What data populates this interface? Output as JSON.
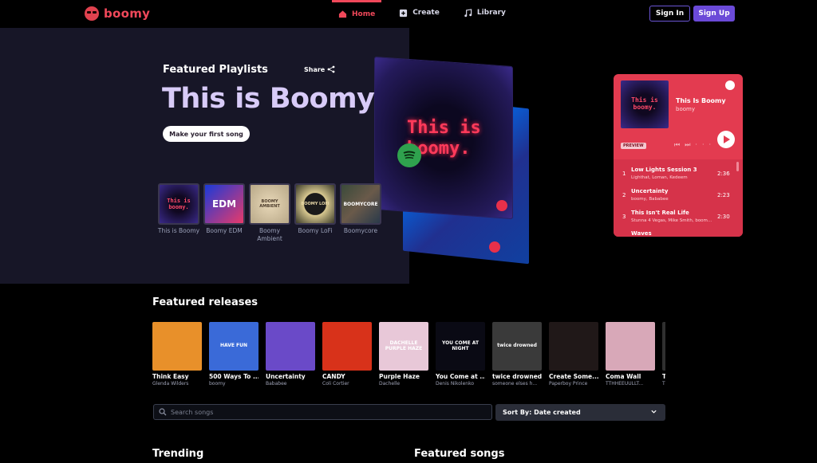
{
  "nav": {
    "logo_text": "boomy",
    "links": [
      {
        "label": "Home",
        "icon": "home-icon"
      },
      {
        "label": "Create",
        "icon": "plus-square-icon"
      },
      {
        "label": "Library",
        "icon": "music-note-icon"
      }
    ],
    "signin_label": "Sign In",
    "signup_label": "Sign Up"
  },
  "hero": {
    "subtitle": "Featured Playlists",
    "share_label": "Share",
    "title": "This is Boomy",
    "cta_label": "Make your first song",
    "playlists": [
      {
        "label": "This is Boomy",
        "art_text": "This is boomy."
      },
      {
        "label": "Boomy EDM",
        "art_text": "EDM"
      },
      {
        "label": "Boomy Ambient",
        "art_text": "BOOMY AMBIENT"
      },
      {
        "label": "Boomy LoFi",
        "art_text": "BOOMY LOFI"
      },
      {
        "label": "Boomycore",
        "art_text": "BOOMYCORE"
      }
    ],
    "cover_text": "This is boomy."
  },
  "spotify": {
    "art_text": "This is boomy.",
    "title": "This Is Boomy",
    "artist": "boomy",
    "preview_label": "PREVIEW",
    "tracks": [
      {
        "num": "1",
        "name": "Low Lights Session 3",
        "artists": "Lighthat, Loman, Kedeem",
        "duration": "2:36"
      },
      {
        "num": "2",
        "name": "Uncertainty",
        "artists": "boomy, Bababee",
        "duration": "2:23"
      },
      {
        "num": "3",
        "name": "This Isn't Real Life",
        "artists": "Stunna 4 Vegas, Mike Smith, boom...",
        "duration": "2:30"
      }
    ],
    "more_track": "Waves"
  },
  "releases": {
    "title": "Featured releases",
    "items": [
      {
        "title": "Think Easy",
        "artist": "Glenda Wilders",
        "bg": "#e8902a",
        "art_text": ""
      },
      {
        "title": "500 Ways To ...",
        "artist": "boomy",
        "bg": "#3a6ad8",
        "art_text": "HAVE FUN"
      },
      {
        "title": "Uncertainty",
        "artist": "Bababee",
        "bg": "#6a4ac8",
        "art_text": ""
      },
      {
        "title": "CANDY",
        "artist": "Coli Cortier",
        "bg": "#d8321a",
        "art_text": ""
      },
      {
        "title": "Purple Haze",
        "artist": "Dachelle",
        "bg": "#e8c8d8",
        "art_text": "DACHELLE PURPLE HAZE"
      },
      {
        "title": "You Come at ...",
        "artist": "Denis Nikolenko",
        "bg": "#0a0a14",
        "art_text": "YOU COME AT NIGHT"
      },
      {
        "title": "twice drowned",
        "artist": "someone elses h...",
        "bg": "#3a3a3a",
        "art_text": "twice drowned"
      },
      {
        "title": "Create Some...",
        "artist": "Paperboy Prince",
        "bg": "#201818",
        "art_text": ""
      },
      {
        "title": "Coma Wall",
        "artist": "TTHHEEUULLT...",
        "bg": "#d8a8b8",
        "art_text": ""
      },
      {
        "title": "T",
        "artist": "T",
        "bg": "#303030",
        "art_text": ""
      }
    ]
  },
  "search": {
    "placeholder": "Search songs"
  },
  "sort": {
    "label": "Sort By: Date created"
  },
  "sections": {
    "trending": "Trending",
    "featured_songs": "Featured songs"
  },
  "colors": {
    "accent": "#f0485a",
    "signup": "#6b4ad8",
    "spotify_card": "#e33b50"
  }
}
